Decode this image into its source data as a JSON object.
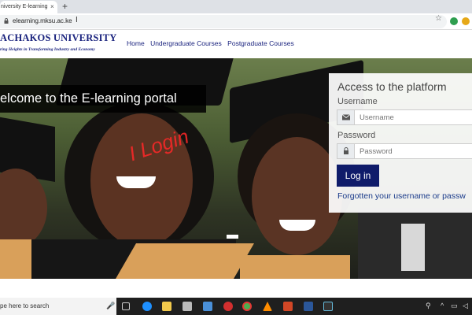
{
  "browser": {
    "tab_title": "niversity E-learning",
    "tab_close": "×",
    "new_tab": "+",
    "url": "elearning.mksu.ac.ke"
  },
  "site": {
    "name": "ACHAKOS UNIVERSITY",
    "motto": "ring Heights in Transforming Industry and Economy",
    "nav": [
      "Home",
      "Undergraduate Courses",
      "Postgraduate Courses"
    ]
  },
  "hero": {
    "welcome": "elcome to the E-learning portal",
    "annotation": "I Login"
  },
  "login": {
    "title": "Access to the platform",
    "username_label": "Username",
    "username_placeholder": "Username",
    "password_label": "Password",
    "password_placeholder": "Password",
    "button": "Log in",
    "forgot": "Forgotten your username or passw"
  },
  "taskbar": {
    "search": "pe here to search"
  },
  "colors": {
    "brand_blue": "#1a237e",
    "login_button": "#0f1b6a",
    "annotation_red": "#ff2828"
  }
}
